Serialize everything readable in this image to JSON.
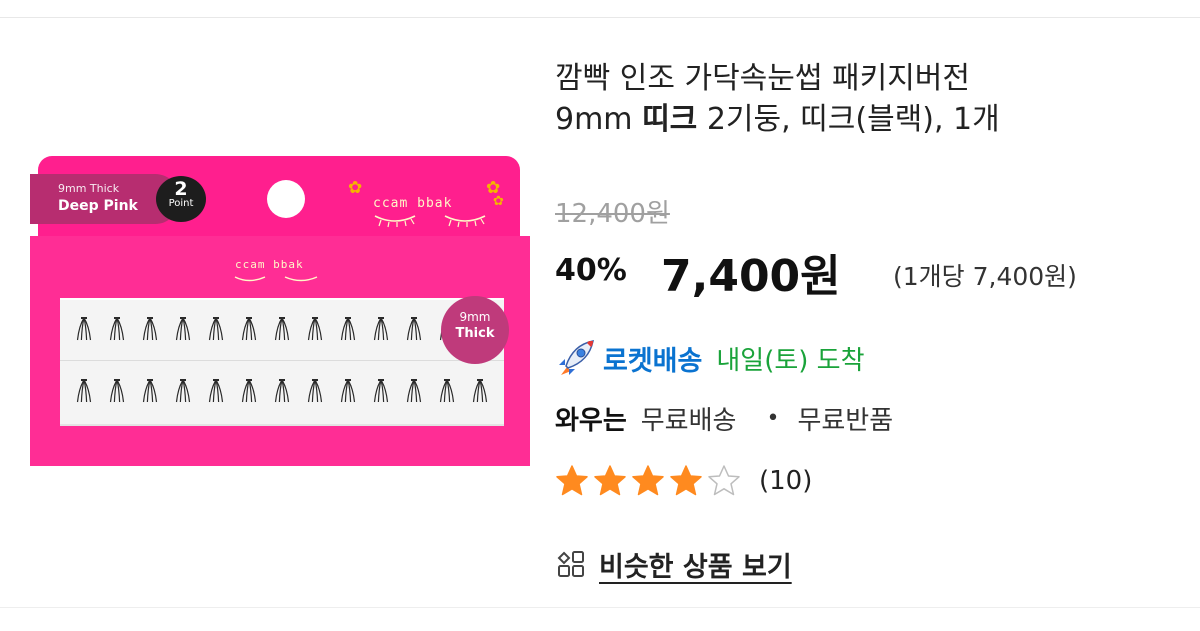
{
  "product": {
    "title_plain_1": "깜빡 인조 가닥속눈썹 패키지버전",
    "title_plain_2": "9mm ",
    "title_bold": "띠크",
    "title_plain_3": " 2기둥, 띠크(블랙), 1개"
  },
  "pack": {
    "tag_small": "9mm Thick",
    "tag_big": "Deep Pink",
    "point_num": "2",
    "point_label": "Point",
    "brand": "ccam bbak",
    "badge_line1": "9mm",
    "badge_line2": "Thick"
  },
  "price": {
    "original": "12,400원",
    "discount_rate": "40%",
    "sale": "7,400원",
    "unit": "(1개당 7,400원)"
  },
  "delivery": {
    "icon": "rocket-icon",
    "label": "로켓배송",
    "arrival": "내일(토) 도착"
  },
  "wow": {
    "label": "와우는",
    "benefit_1": "무료배송",
    "separator": "•",
    "benefit_2": "무료반품"
  },
  "rating": {
    "value": 4,
    "max": 5,
    "review_count": "(10)",
    "star_color": "#ff8a1f"
  },
  "similar": {
    "icon": "grid-icon",
    "label": "비슷한 상품 보기"
  },
  "colors": {
    "rocket_blue": "#0a73d0",
    "arrival_green": "#1aa33a",
    "pack_pink": "#ff2d95"
  }
}
